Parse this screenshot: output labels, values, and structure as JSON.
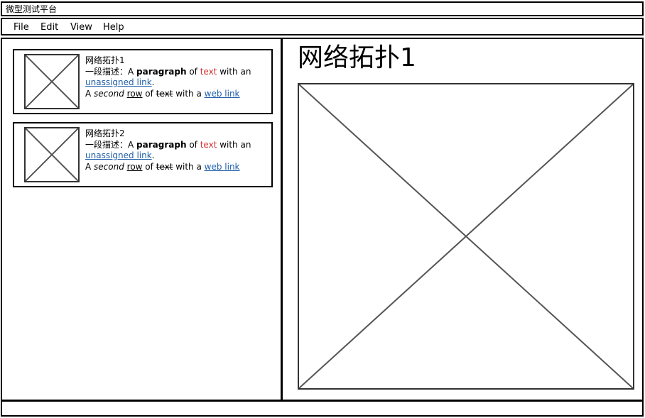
{
  "window": {
    "title": "微型测试平台"
  },
  "menu": {
    "items": [
      "File",
      "Edit",
      "View",
      "Help"
    ]
  },
  "list": {
    "items": [
      {
        "title": "网络拓扑1",
        "desc_prefix": "一段描述：",
        "line1_a": "A ",
        "line1_bold": "paragraph",
        "line1_of": " of ",
        "line1_red": "text",
        "line1_tail": " with an",
        "line2_link": "unassigned link",
        "line2_dot": ".",
        "line3_a": "A ",
        "line3_italic": "second",
        "line3_sp": " ",
        "line3_ul": "row",
        "line3_of": " of ",
        "line3_strike": "text",
        "line3_with": " with a ",
        "line3_link": "web link"
      },
      {
        "title": "网络拓扑2",
        "desc_prefix": "一段描述：",
        "line1_a": "A ",
        "line1_bold": "paragraph",
        "line1_of": " of ",
        "line1_red": "text",
        "line1_tail": " with an",
        "line2_link": "unassigned link",
        "line2_dot": ".",
        "line3_a": "A ",
        "line3_italic": "second",
        "line3_sp": " ",
        "line3_ul": "row",
        "line3_of": " of ",
        "line3_strike": "text",
        "line3_with": " with a ",
        "line3_link": "web link"
      }
    ]
  },
  "detail": {
    "heading": "网络拓扑1"
  },
  "colors": {
    "accent_text": "#d42f2f",
    "link": "#1f5fa8",
    "border": "#000000"
  }
}
